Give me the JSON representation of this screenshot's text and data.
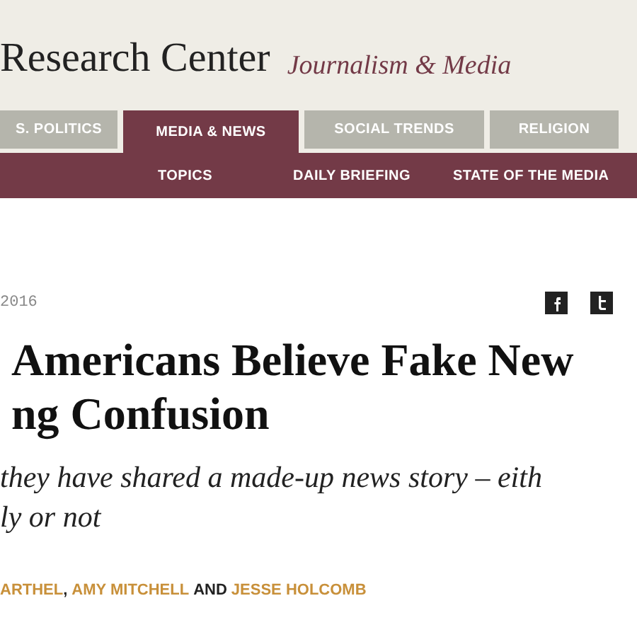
{
  "header": {
    "site_name": "Research Center",
    "section": "Journalism & Media"
  },
  "tabs": [
    {
      "label": "S. POLITICS",
      "selected": false
    },
    {
      "label": "MEDIA & NEWS",
      "selected": true
    },
    {
      "label": "SOCIAL TRENDS",
      "selected": false
    },
    {
      "label": "RELIGION",
      "selected": false
    }
  ],
  "subnav": [
    "TOPICS",
    "DAILY BRIEFING",
    "STATE OF THE MEDIA"
  ],
  "article": {
    "date": "2016",
    "headline": [
      "Americans Believe Fake New",
      "ng Confusion"
    ],
    "subtitle": [
      "they have shared a made-up news story – eith",
      "ly or not"
    ],
    "byline": [
      {
        "kind": "author",
        "text": "ARTHEL"
      },
      {
        "kind": "sep",
        "text": ","
      },
      {
        "kind": "author",
        "text": "AMY MITCHELL"
      },
      {
        "kind": "sep",
        "text": "AND"
      },
      {
        "kind": "author",
        "text": "JESSE HOLCOMB"
      }
    ]
  }
}
